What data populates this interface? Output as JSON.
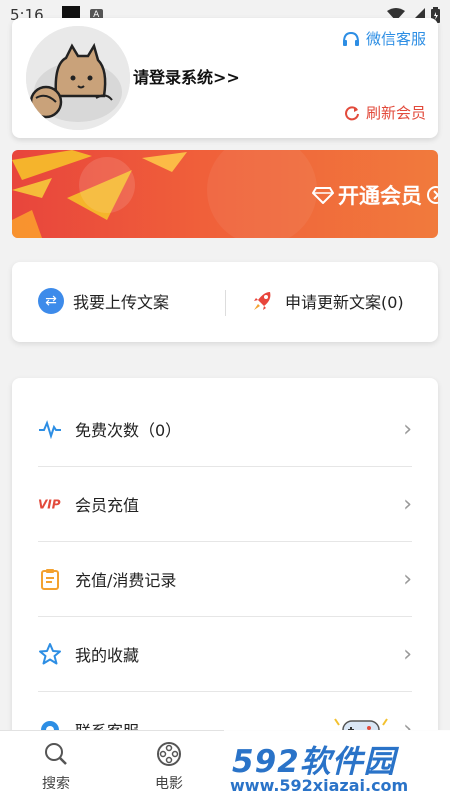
{
  "status_bar": {
    "time": "5:16",
    "a_badge": "A"
  },
  "profile": {
    "login_prompt": "请登录系统>>",
    "service_label": "微信客服",
    "refresh_label": "刷新会员"
  },
  "banner": {
    "text": "开通会员"
  },
  "upload": {
    "upload_label": "我要上传文案",
    "request_label": "申请更新文案(0)"
  },
  "menu": {
    "items": [
      {
        "label": "免费次数（0）",
        "icon": "pulse-icon"
      },
      {
        "label": "会员充值",
        "icon": "vip-icon"
      },
      {
        "label": "充值/消费记录",
        "icon": "clipboard-icon"
      },
      {
        "label": "我的收藏",
        "icon": "star-icon"
      },
      {
        "label": "联系客服",
        "icon": "service-icon"
      }
    ]
  },
  "nav": {
    "items": [
      {
        "label": "搜索",
        "icon": "search-icon"
      },
      {
        "label": "电影",
        "icon": "film-reel-icon"
      }
    ]
  },
  "watermark": {
    "brand": "592软件园",
    "url": "www.592xiazai.com"
  },
  "colors": {
    "accent_blue": "#2d8ee4",
    "accent_red": "#e24a3b",
    "banner_gradient": [
      "#e8453c",
      "#f17a3c"
    ]
  }
}
